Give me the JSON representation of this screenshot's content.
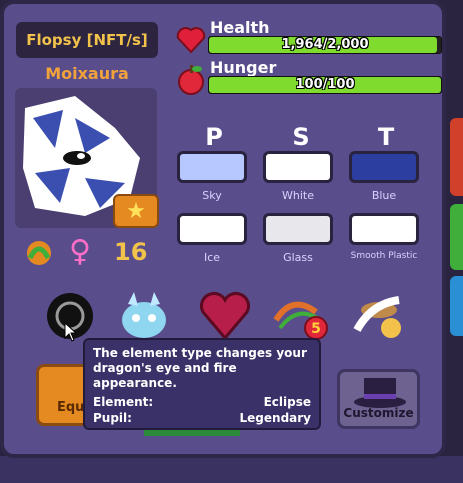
{
  "pet": {
    "name": "Flopsy [NFT/s]",
    "species": "Moixaura",
    "age": "16"
  },
  "stats": {
    "health": {
      "label": "Health",
      "value": "1,964/2,000",
      "fraction": 0.982
    },
    "hunger": {
      "label": "Hunger",
      "value": "100/100",
      "fraction": 1.0
    }
  },
  "colors": {
    "headers": [
      "P",
      "S",
      "T"
    ],
    "row1": [
      {
        "name": "Sky",
        "hex": "#b6c8ff"
      },
      {
        "name": "White",
        "hex": "#ffffff"
      },
      {
        "name": "Blue",
        "hex": "#2c3fa0"
      }
    ],
    "row2": [
      {
        "name": "Ice",
        "hex": "#ffffff"
      },
      {
        "name": "Glass",
        "hex": "#e8e8ec"
      },
      {
        "name": "Smooth Plastic",
        "hex": "#ffffff"
      }
    ]
  },
  "tooltip": {
    "description": "The element type changes your dragon's eye and fire appearance.",
    "element_label": "Element:",
    "element_value": "Eclipse",
    "pupil_label": "Pupil:",
    "pupil_value": "Legendary"
  },
  "buttons": {
    "equip": "Equ",
    "customize": "Customize"
  },
  "icons": {
    "gene_badge": "5"
  }
}
